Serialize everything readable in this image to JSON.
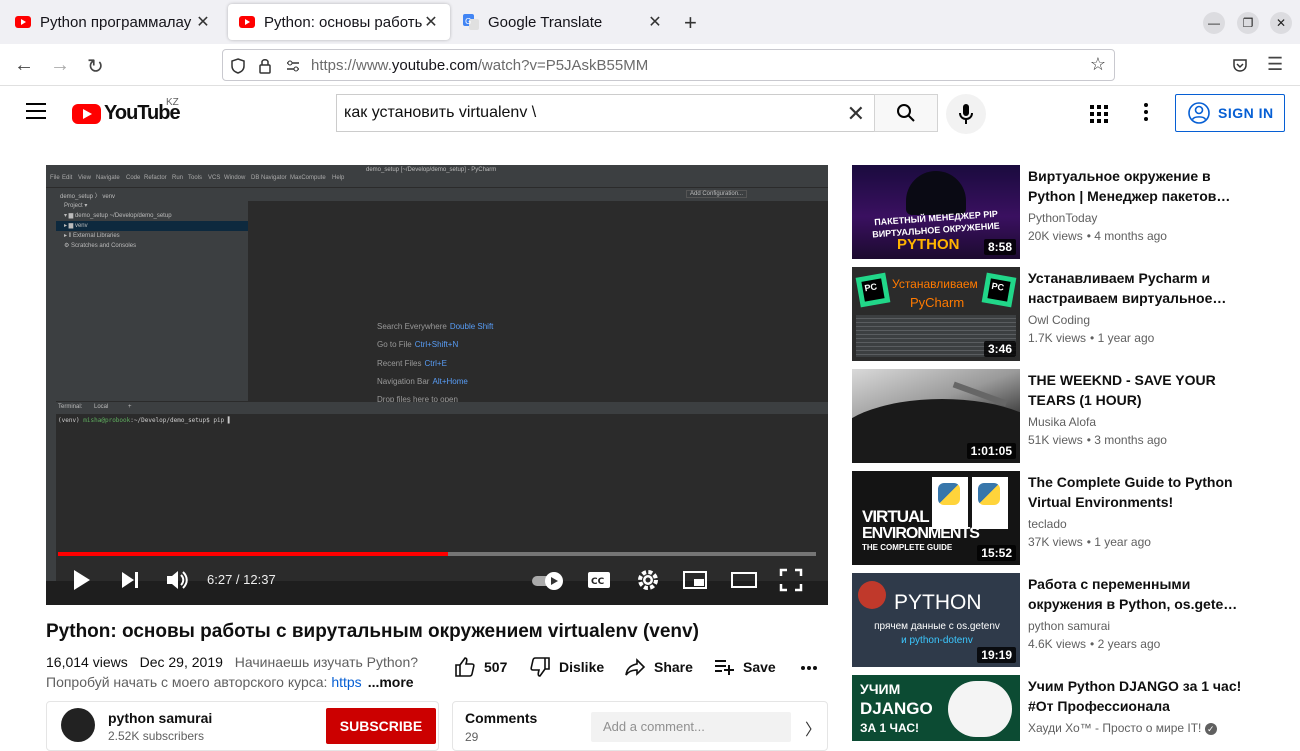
{
  "browser": {
    "tabs": [
      {
        "label": "Python программалау ті",
        "active": false
      },
      {
        "label": "Python: основы работы",
        "active": true
      },
      {
        "label": "Google Translate",
        "active": false
      }
    ],
    "url_prefix": "https://www.",
    "url_domain": "youtube.com",
    "url_path": "/watch?v=P5JAskB55MM"
  },
  "youtube": {
    "logo_text": "YouTube",
    "country": "KZ",
    "search_query": "как установить virtualenv \\",
    "sign_in_label": "SIGN IN"
  },
  "player": {
    "ide": {
      "window_title": "demo_setup [~/Develop/demo_setup] - PyCharm",
      "menu": [
        "File",
        "Edit",
        "View",
        "Navigate",
        "Code",
        "Refactor",
        "Run",
        "Tools",
        "VCS",
        "Window",
        "DB Navigator",
        "MaxCompute",
        "Help"
      ],
      "breadcrumb": "demo_setup  〉 venv",
      "add_config": "Add Configuration...",
      "project_header": "Project ▾",
      "tree": [
        "▾ ▆ demo_setup  ~/Develop/demo_setup",
        "▸ ▆ venv",
        "▸ ⦀ External Libraries",
        "   ⚙ Scratches and Consoles"
      ],
      "hints": [
        {
          "label": "Search Everywhere",
          "key": "Double Shift"
        },
        {
          "label": "Go to File",
          "key": "Ctrl+Shift+N"
        },
        {
          "label": "Recent Files",
          "key": "Ctrl+E"
        },
        {
          "label": "Navigation Bar",
          "key": "Alt+Home"
        },
        {
          "label": "Drop files here to open",
          "key": ""
        }
      ],
      "terminal_tabs": [
        "Terminal:",
        "Local",
        "+"
      ],
      "terminal_prompt_env": "(venv) ",
      "terminal_prompt_user": "misha@probook",
      "terminal_prompt_rest": ":~/Develop/demo_setup$ pip ▌"
    },
    "progress_fraction": 0.515,
    "time": "6:27 / 12:37"
  },
  "video": {
    "title": "Python: основы работы с вирутальным окружением virtualenv (venv)",
    "views": "16,014 views",
    "date": "Dec 29, 2019",
    "promo": "Начинаешь изучать Python?",
    "desc": "Попробуй начать с моего авторского курса: ",
    "desc_link": "https",
    "more": "...more",
    "likes": "507",
    "dislike": "Dislike",
    "share": "Share",
    "save": "Save"
  },
  "channel": {
    "name": "python samurai",
    "subs": "2.52K subscribers",
    "subscribe": "SUBSCRIBE"
  },
  "comments": {
    "title": "Comments",
    "count": "29",
    "placeholder": "Add a comment..."
  },
  "recommendations": [
    {
      "title": "Виртуальное окружение в Python | Менеджер пакетов…",
      "channel": "PythonToday",
      "views": "20K views",
      "age": "4 months ago",
      "duration": "8:58",
      "thumb": {
        "line1": "ПАКЕТНЫЙ МЕНЕДЖЕР PIP",
        "line2": "ВИРТУАЛЬНОЕ ОКРУЖЕНИЕ",
        "line3": "PYTHON",
        "colors": [
          "#1a0b3e",
          "#e0308a",
          "#ff9a00"
        ]
      }
    },
    {
      "title": "Устанавливаем Pycharm и настраиваем виртуальное…",
      "channel": "Owl Coding",
      "views": "1.7K views",
      "age": "1 year ago",
      "duration": "3:46",
      "thumb": {
        "line1": "Устанавливаем",
        "line2": "PyCharm",
        "badge": "PC",
        "colors": [
          "#2b2b2b",
          "#ff7a00",
          "#21d789"
        ]
      }
    },
    {
      "title": "THE WEEKND - SAVE YOUR TEARS (1 HOUR)",
      "channel": "Musika Alofa",
      "views": "51K views",
      "age": "3 months ago",
      "duration": "1:01:05",
      "thumb": {
        "colors": [
          "#bdbdbd",
          "#2a2a2a",
          "#6b6b6b"
        ]
      }
    },
    {
      "title": "The Complete Guide to Python Virtual Environments!",
      "channel": "teclado",
      "views": "37K views",
      "age": "1 year ago",
      "duration": "15:52",
      "thumb": {
        "line1": "VIRTUAL",
        "line2": "ENVIRONMENTS",
        "line3": "THE COMPLETE GUIDE",
        "colors": [
          "#111",
          "#fff",
          "#ffd43b"
        ]
      }
    },
    {
      "title": "Работа с переменными окружения в Python, os.gete…",
      "channel": "python samurai",
      "views": "4.6K views",
      "age": "2 years ago",
      "duration": "19:19",
      "thumb": {
        "line1": "PYTHON",
        "line2": "прячем данные с os.getenv",
        "line3": "и python-dotenv",
        "colors": [
          "#2f3a4a",
          "#ff9b2b",
          "#3cc8ff"
        ]
      }
    },
    {
      "title": "Учим Python DJANGO за 1 час! #От Профессионала",
      "channel": "Хауди Хо™ - Просто о мире IT!",
      "views": "",
      "age": "",
      "duration": "",
      "thumb": {
        "line1": "УЧИМ",
        "line2": "DJANGO",
        "line3": "ЗА 1 ЧАС!",
        "colors": [
          "#0c4b33",
          "#44b78b",
          "#fff"
        ]
      }
    }
  ]
}
